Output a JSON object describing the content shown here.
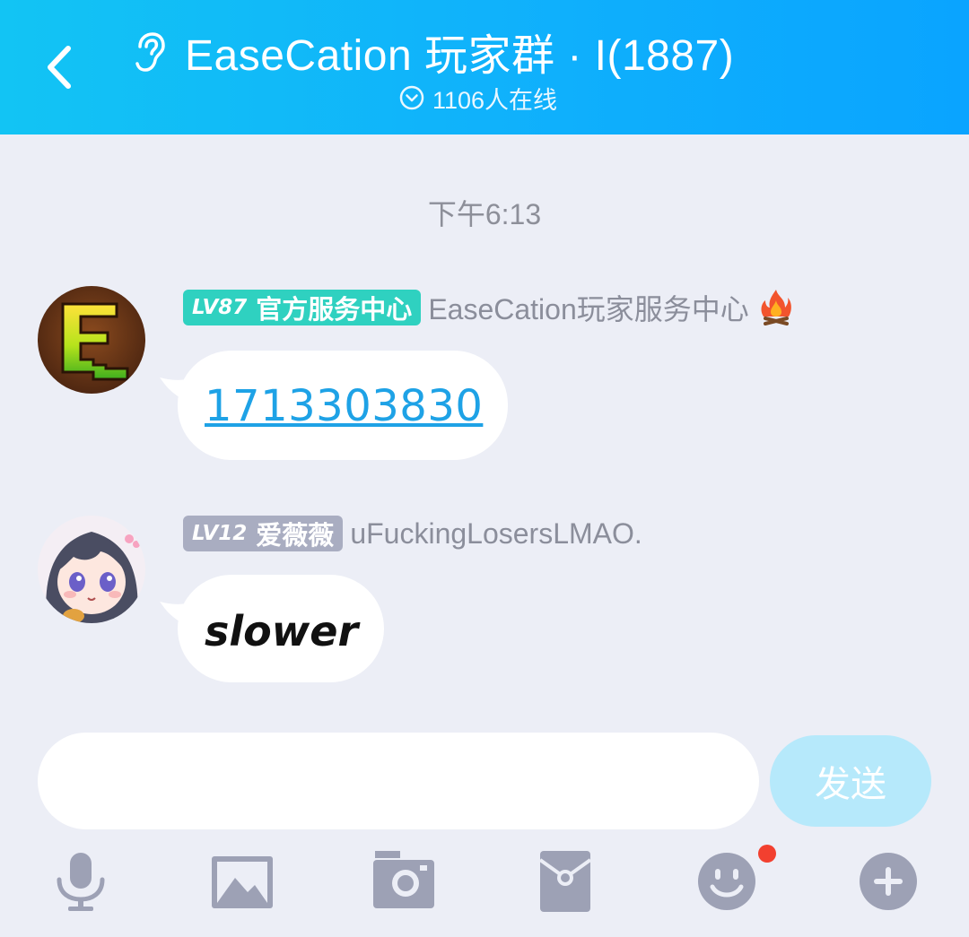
{
  "header": {
    "title": "EaseCation 玩家群 · I(1887)",
    "online": "1106人在线",
    "bg_color": "#10b2fb"
  },
  "chat": {
    "timestamp": "下午6:13",
    "messages": [
      {
        "level": "LV87",
        "title": "官方服务中心",
        "nickname": "EaseCation玩家服务中心",
        "badge_color": "#2fd1c0",
        "avatar": "easecation-logo-avatar",
        "extra_icon": "fire-icon",
        "text": "1713303830",
        "text_type": "link"
      },
      {
        "level": "LV12",
        "title": "爱薇薇",
        "nickname": "uFuckingLosersLMAO.",
        "badge_color": "#a9adc1",
        "avatar": "anime-girl-avatar",
        "text": "slower",
        "text_type": "plain"
      }
    ]
  },
  "input": {
    "placeholder": "",
    "value": "",
    "send_label": "发送",
    "send_color": "#b6e9fb"
  },
  "toolbar": {
    "icons": [
      "microphone-icon",
      "image-icon",
      "camera-icon",
      "red-packet-icon",
      "emoji-icon",
      "plus-icon"
    ],
    "icon_color": "#9da1b5",
    "emoji_has_notification": true
  }
}
